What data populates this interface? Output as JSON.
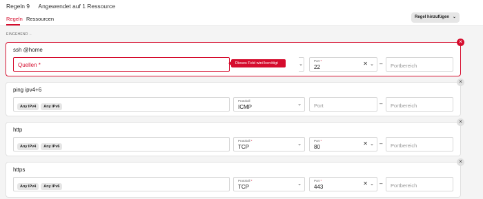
{
  "header": {
    "rules_count": "Regeln 9",
    "applied": "Angewendet auf 1 Ressource",
    "tabs": [
      {
        "label": "Regeln"
      },
      {
        "label": "Ressourcen"
      }
    ],
    "add_button": "Regel hinzufügen"
  },
  "section": {
    "label": "EINGEHEND",
    "arrow": "←"
  },
  "tooltip": "Dieses Feld wird benötigt",
  "rules": [
    {
      "name": "ssh @home",
      "sources_placeholder": "Quellen *",
      "tags": [],
      "protocol_label": "",
      "protocol": "",
      "port_label": "Port",
      "port": "22",
      "port_range_placeholder": "Portbereich"
    },
    {
      "name": "ping ipv4+6",
      "sources_placeholder": "",
      "tags": [
        "Any IPv4",
        "Any IPv6"
      ],
      "protocol_label": "Protokoll",
      "protocol": "ICMP",
      "port_label": "",
      "port": "",
      "port_placeholder": "Port",
      "port_range_placeholder": "Portbereich"
    },
    {
      "name": "http",
      "sources_placeholder": "",
      "tags": [
        "Any IPv4",
        "Any IPv6"
      ],
      "protocol_label": "Protokoll",
      "protocol": "TCP",
      "port_label": "Port",
      "port": "80",
      "port_range_placeholder": "Portbereich"
    },
    {
      "name": "https",
      "sources_placeholder": "",
      "tags": [
        "Any IPv4",
        "Any IPv6"
      ],
      "protocol_label": "Protokoll",
      "protocol": "TCP",
      "port_label": "Port",
      "port": "443",
      "port_range_placeholder": "Portbereich"
    }
  ],
  "colors": {
    "accent": "#d50c2d",
    "background": "#f4f4f4"
  },
  "icons": {
    "delete": "close-icon",
    "dropdown": "chevron-down-icon",
    "clear": "clear-icon"
  }
}
